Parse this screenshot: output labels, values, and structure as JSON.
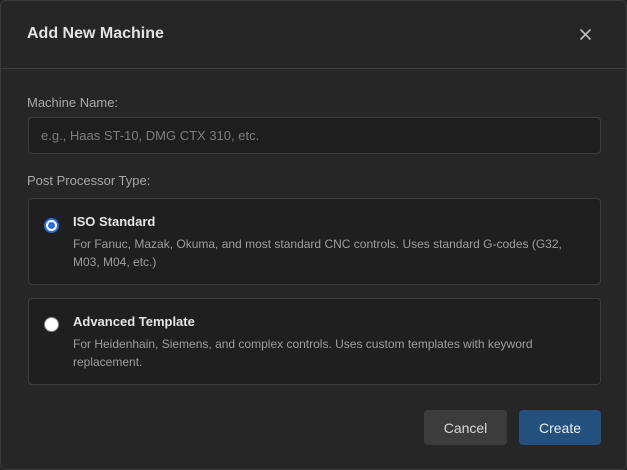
{
  "dialog": {
    "title": "Add New Machine",
    "close_icon": "close-icon"
  },
  "form": {
    "machine_name_label": "Machine Name:",
    "machine_name_value": "",
    "machine_name_placeholder": "e.g., Haas ST-10, DMG CTX 310, etc.",
    "post_processor_label": "Post Processor Type:",
    "options": [
      {
        "title": "ISO Standard",
        "description": "For Fanuc, Mazak, Okuma, and most standard CNC controls. Uses standard G-codes (G32, M03, M04, etc.)",
        "selected": true
      },
      {
        "title": "Advanced Template",
        "description": "For Heidenhain, Siemens, and complex controls. Uses custom templates with keyword replacement.",
        "selected": false
      }
    ]
  },
  "buttons": {
    "cancel_label": "Cancel",
    "create_label": "Create"
  },
  "colors": {
    "accent": "#2b6de0",
    "primary_button": "#24507e",
    "background": "#262626"
  }
}
